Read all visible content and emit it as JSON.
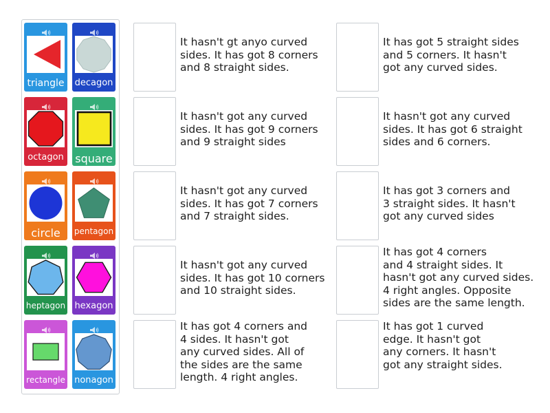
{
  "tiles": [
    {
      "label": "triangle",
      "bg": "#2996e0"
    },
    {
      "label": "decagon",
      "bg": "#1f47c5"
    },
    {
      "label": "octagon",
      "bg": "#d7263a"
    },
    {
      "label": "square",
      "bg": "#34ad78"
    },
    {
      "label": "circle",
      "bg": "#ef7a1d"
    },
    {
      "label": "pentagon",
      "bg": "#e7521b"
    },
    {
      "label": "heptagon",
      "bg": "#23934d"
    },
    {
      "label": "hexagon",
      "bg": "#7a37c4"
    },
    {
      "label": "rectangle",
      "bg": "#cb56d8"
    },
    {
      "label": "nonagon",
      "bg": "#2996e0"
    }
  ],
  "clues_left": [
    [
      "It hasn't gt anyo curved",
      "sides. It has got 8 corners",
      "and 8 straight sides."
    ],
    [
      "It hasn't got any curved",
      "sides. It has got 9 corners",
      "and 9 straight sides"
    ],
    [
      "It hasn't got any curved",
      "sides. It has got 7 corners",
      "and 7 straight sides."
    ],
    [
      "It hasn't got any curved",
      "sides. It has got 10 corners",
      "and 10 straight sides."
    ],
    [
      "It has got 4 corners and",
      "4 sides. It hasn't got",
      "any curved sides. All of",
      "the sides are the same",
      "length. 4 right angles."
    ]
  ],
  "clues_right": [
    [
      "It has got 5 straight sides",
      "and 5 corners. It hasn't",
      "got any curved sides."
    ],
    [
      "It hasn't got any curved",
      "sides. It has got 6 straight",
      "sides and 6 corners."
    ],
    [
      "It has got 3 corners and",
      "3 straight sides. It hasn't",
      "got any curved sides"
    ],
    [
      "It has got 4 corners",
      "and 4 straight sides. It",
      "hasn't got any curved sides.",
      "4 right angles. Opposite",
      "sides are the same length."
    ],
    [
      "It has got 1 curved",
      "edge. It hasn't got",
      "any corners. It hasn't",
      "got any straight sides."
    ]
  ],
  "icons": {
    "speaker": "speaker-icon"
  },
  "shape_colors": {
    "triangle": "#e5252b",
    "decagon": "#c9d8d6",
    "octagon": "#e5171d",
    "square": "#f6e91e",
    "circle": "#1d35d6",
    "pentagon": "#3f8e73",
    "heptagon": "#6cb6ec",
    "hexagon": "#ff10dd",
    "rectangle": "#66d96b",
    "nonagon": "#6497cf"
  }
}
